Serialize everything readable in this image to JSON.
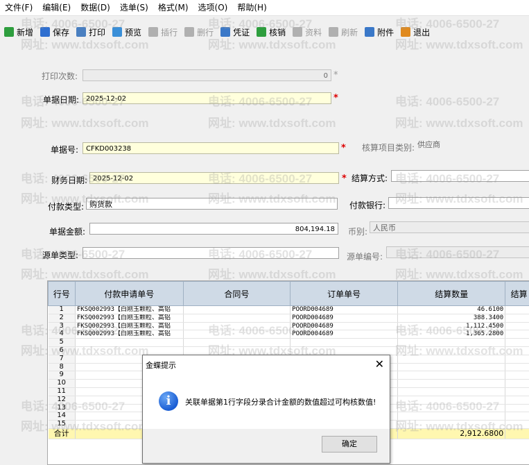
{
  "menu": [
    "文件(F)",
    "编辑(E)",
    "数据(D)",
    "选单(S)",
    "格式(M)",
    "选项(O)",
    "帮助(H)"
  ],
  "toolbar": [
    {
      "label": "新增",
      "icon": "add-icon",
      "color": "#2e9e3e",
      "enabled": true
    },
    {
      "label": "保存",
      "icon": "save-icon",
      "color": "#2f6fd0",
      "enabled": true
    },
    {
      "label": "打印",
      "icon": "print-icon",
      "color": "#4a7fc0",
      "enabled": true
    },
    {
      "label": "预览",
      "icon": "preview-icon",
      "color": "#3a8fd8",
      "enabled": true
    },
    {
      "label": "插行",
      "icon": "insert-row-icon",
      "color": "#b0b0b0",
      "enabled": false
    },
    {
      "label": "删行",
      "icon": "delete-row-icon",
      "color": "#b0b0b0",
      "enabled": false
    },
    {
      "label": "凭证",
      "icon": "voucher-icon",
      "color": "#3a78c8",
      "enabled": true
    },
    {
      "label": "核销",
      "icon": "verify-icon",
      "color": "#2e9e3e",
      "enabled": true
    },
    {
      "label": "资料",
      "icon": "data-icon",
      "color": "#b0b0b0",
      "enabled": false
    },
    {
      "label": "刷新",
      "icon": "refresh-icon",
      "color": "#b0b0b0",
      "enabled": false
    },
    {
      "label": "附件",
      "icon": "attach-icon",
      "color": "#3a78c8",
      "enabled": true
    },
    {
      "label": "退出",
      "icon": "exit-icon",
      "color": "#e08a1e",
      "enabled": true
    }
  ],
  "form": {
    "print_count_label": "打印次数:",
    "print_count": "0",
    "bill_date_label": "单据日期:",
    "bill_date": "2025-12-02",
    "bill_no_label": "单据号:",
    "bill_no": "CFKD003238",
    "account_type_label": "核算项目类别:",
    "account_type": "供应商",
    "fin_date_label": "财务日期:",
    "fin_date": "2025-12-02",
    "settle_label": "结算方式:",
    "settle": "",
    "pay_type_label": "付款类型:",
    "pay_type": "购货款",
    "pay_bank_label": "付款银行:",
    "pay_bank": "",
    "amount_label": "单据金额:",
    "amount": "804,194.18",
    "currency_label": "币别:",
    "currency": "人民币",
    "src_type_label": "源单类型:",
    "src_type": "",
    "src_no_label": "源单编号:",
    "src_no": ""
  },
  "grid": {
    "headers": [
      "行号",
      "付款申请单号",
      "合同号",
      "订单单号",
      "结算数量",
      "结算"
    ],
    "rows": [
      {
        "no": "1",
        "req": "FKSQ002993【白刚玉颗粒、高铝",
        "contract": "",
        "order": "POORD004689",
        "qty": "46.6100"
      },
      {
        "no": "2",
        "req": "FKSQ002993【白刚玉颗粒、高铝",
        "contract": "",
        "order": "POORD004689",
        "qty": "388.3400"
      },
      {
        "no": "3",
        "req": "FKSQ002993【白刚玉颗粒、高铝",
        "contract": "",
        "order": "POORD004689",
        "qty": "1,112.4500"
      },
      {
        "no": "4",
        "req": "FKSQ002993【白刚玉颗粒、高铝",
        "contract": "",
        "order": "POORD004689",
        "qty": "1,365.2800"
      },
      {
        "no": "5",
        "req": "",
        "contract": "",
        "order": "",
        "qty": ""
      },
      {
        "no": "6",
        "req": "",
        "contract": "",
        "order": "",
        "qty": ""
      },
      {
        "no": "7",
        "req": "",
        "contract": "",
        "order": "",
        "qty": ""
      },
      {
        "no": "8",
        "req": "",
        "contract": "",
        "order": "",
        "qty": ""
      },
      {
        "no": "9",
        "req": "",
        "contract": "",
        "order": "",
        "qty": ""
      },
      {
        "no": "10",
        "req": "",
        "contract": "",
        "order": "",
        "qty": ""
      },
      {
        "no": "11",
        "req": "",
        "contract": "",
        "order": "",
        "qty": ""
      },
      {
        "no": "12",
        "req": "",
        "contract": "",
        "order": "",
        "qty": ""
      },
      {
        "no": "13",
        "req": "",
        "contract": "",
        "order": "",
        "qty": ""
      },
      {
        "no": "14",
        "req": "",
        "contract": "",
        "order": "",
        "qty": ""
      },
      {
        "no": "15",
        "req": "",
        "contract": "",
        "order": "",
        "qty": ""
      }
    ],
    "total_label": "合计",
    "total_qty": "2,912.6800"
  },
  "dialog": {
    "title": "金蝶提示",
    "message": "关联单据第1行字段分录合计金额的数值超过可构核数值!",
    "ok_label": "确定",
    "icon": "info-icon"
  },
  "watermark": {
    "phone": "电话: 4006-6500-27",
    "site": "网址: www.tdxsoft.com"
  }
}
